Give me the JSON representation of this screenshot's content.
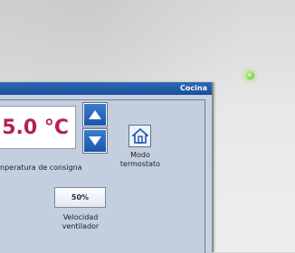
{
  "device": {
    "status_led_color": "#8ee05c"
  },
  "screen": {
    "room_name": "Cocina",
    "setpoint": {
      "value_text": "5.0 °C",
      "label": "nperatura de consigna",
      "value_color": "#b51f57"
    },
    "controls": {
      "increase_icon": "arrow-up-icon",
      "decrease_icon": "arrow-down-icon"
    },
    "mode": {
      "icon": "house-thermostat-icon",
      "label_line1": "Modo",
      "label_line2": "termostato"
    },
    "fan": {
      "speed_text": "50%",
      "label_line1": "Velocidad",
      "label_line2": "ventilador"
    },
    "accent_color": "#1d55a8"
  }
}
